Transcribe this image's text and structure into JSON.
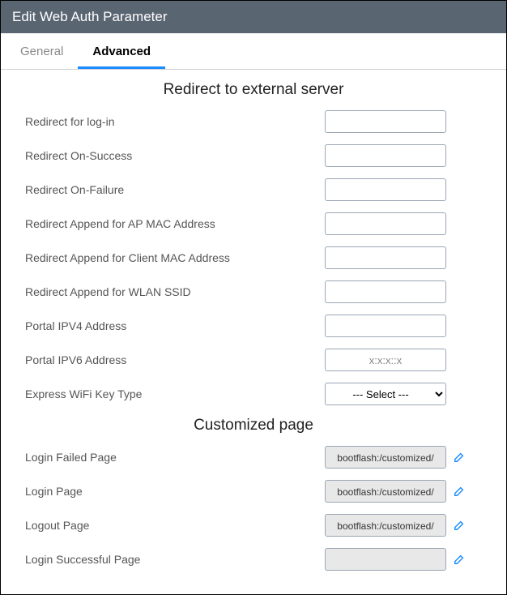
{
  "header": {
    "title": "Edit Web Auth Parameter"
  },
  "tabs": {
    "general": "General",
    "advanced": "Advanced",
    "active": "advanced"
  },
  "section_redirect": {
    "heading": "Redirect to external server",
    "fields": {
      "redirect_login": {
        "label": "Redirect for log-in",
        "value": ""
      },
      "redirect_success": {
        "label": "Redirect On-Success",
        "value": ""
      },
      "redirect_failure": {
        "label": "Redirect On-Failure",
        "value": ""
      },
      "append_ap_mac": {
        "label": "Redirect Append for AP MAC Address",
        "value": ""
      },
      "append_client_mac": {
        "label": "Redirect Append for Client MAC Address",
        "value": ""
      },
      "append_wlan_ssid": {
        "label": "Redirect Append for WLAN SSID",
        "value": ""
      },
      "portal_ipv4": {
        "label": "Portal IPV4 Address",
        "value": ""
      },
      "portal_ipv6": {
        "label": "Portal IPV6 Address",
        "value": "",
        "placeholder": "x:x:x::x"
      },
      "express_wifi_key": {
        "label": "Express WiFi Key Type",
        "selected": "--- Select ---"
      }
    }
  },
  "section_custom": {
    "heading": "Customized page",
    "fields": {
      "login_failed": {
        "label": "Login Failed Page",
        "value": "bootflash:/customized/"
      },
      "login_page": {
        "label": "Login Page",
        "value": "bootflash:/customized/"
      },
      "logout_page": {
        "label": "Logout Page",
        "value": "bootflash:/customized/"
      },
      "login_success": {
        "label": "Login Successful Page",
        "value": ""
      }
    }
  }
}
